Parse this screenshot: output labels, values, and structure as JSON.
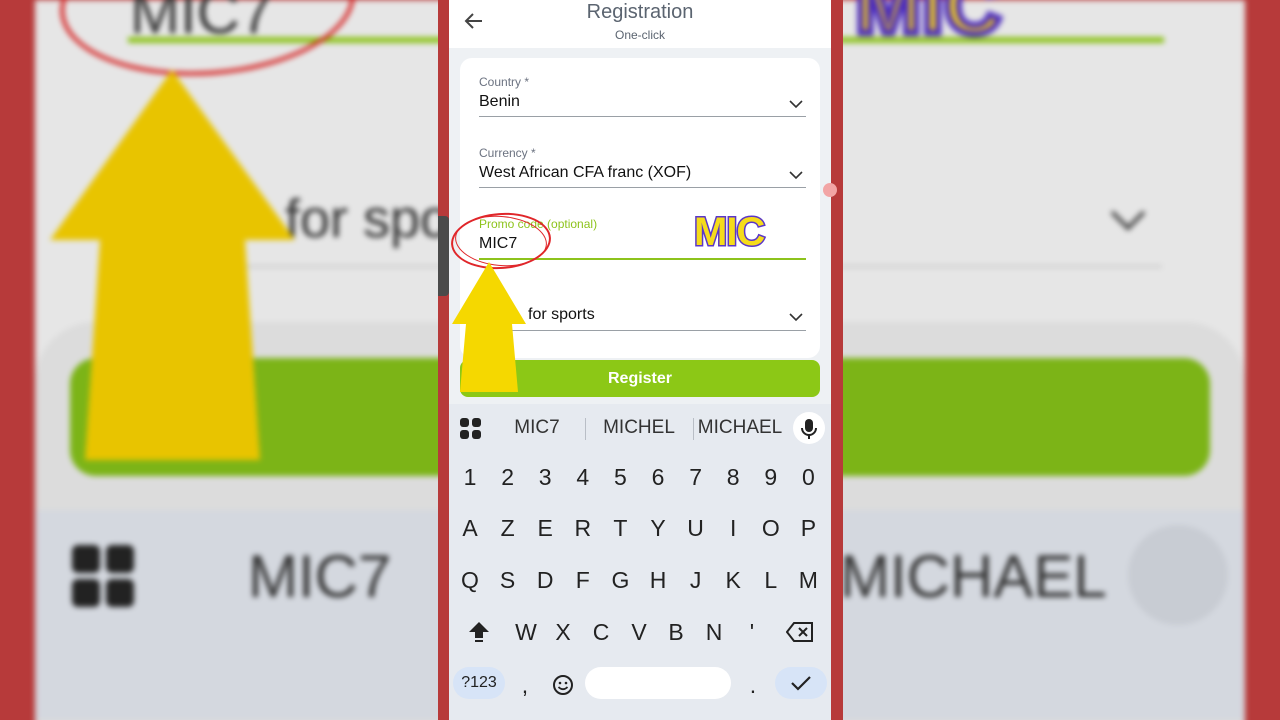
{
  "header": {
    "title": "Registration",
    "subtitle": "One-click"
  },
  "form": {
    "country": {
      "label": "Country *",
      "value": "Benin"
    },
    "currency": {
      "label": "Currency *",
      "value": "West African CFA franc (XOF)"
    },
    "promo": {
      "label": "Promo code (optional)",
      "value": "MIC7"
    },
    "bonus": {
      "value": "for sports"
    },
    "register_label": "Register"
  },
  "keyboard": {
    "suggestions": [
      "MIC7",
      "MICHEL",
      "MICHAEL"
    ],
    "row_digits": [
      "1",
      "2",
      "3",
      "4",
      "5",
      "6",
      "7",
      "8",
      "9",
      "0"
    ],
    "row1": [
      "A",
      "Z",
      "E",
      "R",
      "T",
      "Y",
      "U",
      "I",
      "O",
      "P"
    ],
    "row2": [
      "Q",
      "S",
      "D",
      "F",
      "G",
      "H",
      "J",
      "K",
      "L",
      "M"
    ],
    "row3": [
      "W",
      "X",
      "C",
      "V",
      "B",
      "N",
      "'"
    ],
    "sym_label": "?123",
    "comma": ",",
    "period": "."
  },
  "overlay": {
    "tag": "MIC"
  },
  "colors": {
    "accent": "#8cc816",
    "frame": "#b73a3a",
    "annotation_red": "#e0262a",
    "arrow_yellow": "#f5d800",
    "tag_purple": "#5a36c9"
  },
  "icons": [
    "back-arrow-icon",
    "chevron-down-icon",
    "apps-grid-icon",
    "microphone-icon",
    "shift-icon",
    "backspace-icon",
    "emoji-icon",
    "check-icon"
  ]
}
